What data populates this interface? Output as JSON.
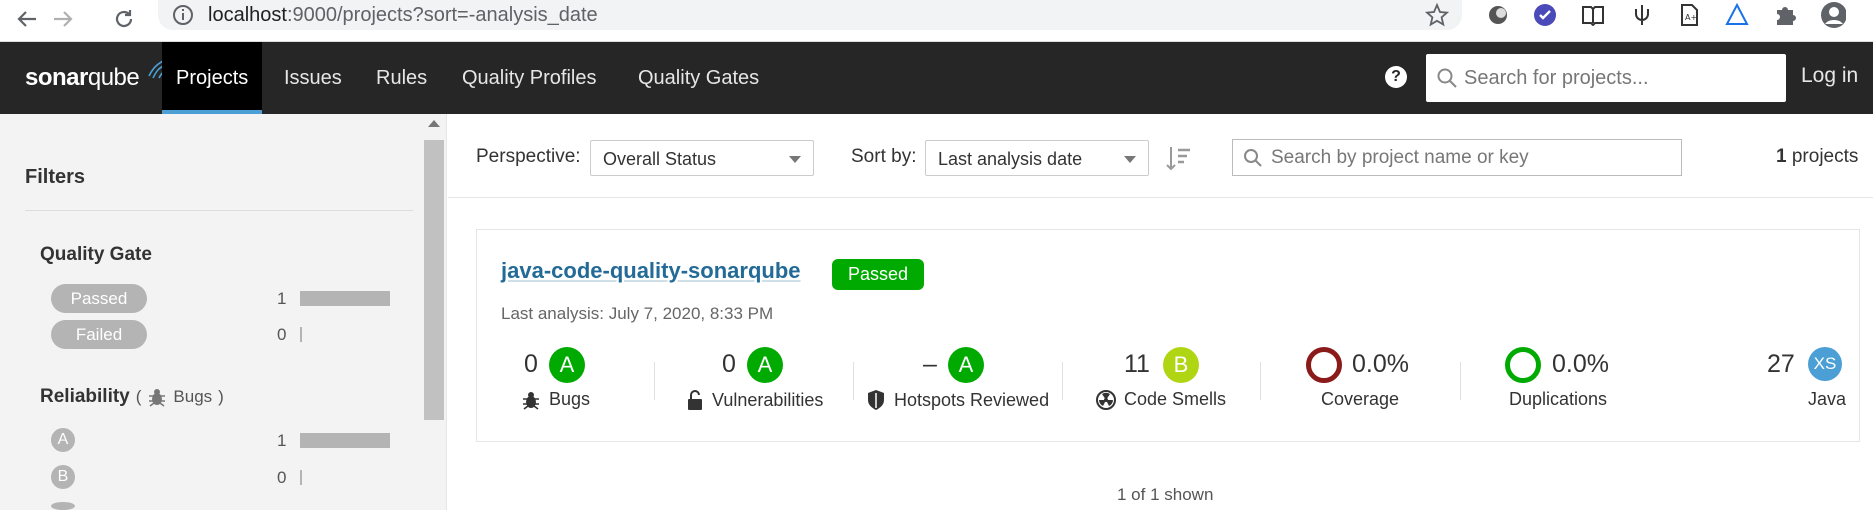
{
  "browser": {
    "url_host": "localhost",
    "url_rest": ":9000/projects?sort=-analysis_date",
    "icons": [
      "back-arrow-icon",
      "forward-arrow-icon",
      "reload-icon",
      "info-icon",
      "star-icon",
      "extension-icons",
      "puzzle-icon",
      "profile-icon"
    ]
  },
  "navbar": {
    "logo_bold": "sonar",
    "logo_rest": "qube",
    "items": [
      "Projects",
      "Issues",
      "Rules",
      "Quality Profiles",
      "Quality Gates"
    ],
    "active": "Projects",
    "help_label": "?",
    "search_placeholder": "Search for projects...",
    "login_label": "Log in",
    "colors": {
      "bg": "#262626",
      "active_underline": "#4b9fd5"
    }
  },
  "sidebar": {
    "title": "Filters",
    "quality_gate": {
      "title": "Quality Gate",
      "items": [
        {
          "label": "Passed",
          "count": "1",
          "fraction": 1.0
        },
        {
          "label": "Failed",
          "count": "0",
          "fraction": 0.0
        }
      ]
    },
    "reliability": {
      "title": "Reliability",
      "paren_open": "(",
      "sub": "Bugs",
      "paren_close": ")",
      "items": [
        {
          "label": "A",
          "count": "1",
          "fraction": 1.0
        },
        {
          "label": "B",
          "count": "0",
          "fraction": 0.0
        }
      ]
    }
  },
  "toolbar": {
    "perspective_label": "Perspective:",
    "perspective_value": "Overall Status",
    "sort_label": "Sort by:",
    "sort_value": "Last analysis date",
    "search_placeholder": "Search by project name or key",
    "count": "1",
    "count_suffix": "projects"
  },
  "project": {
    "name": "java-code-quality-sonarqube",
    "status": "Passed",
    "last_analysis": "Last analysis: July 7, 2020, 8:33 PM",
    "metrics": {
      "bugs": {
        "value": "0",
        "grade": "A",
        "label": "Bugs"
      },
      "vulnerabilities": {
        "value": "0",
        "grade": "A",
        "label": "Vulnerabilities"
      },
      "hotspots": {
        "value": "–",
        "grade": "A",
        "label": "Hotspots Reviewed"
      },
      "code_smells": {
        "value": "11",
        "grade": "B",
        "label": "Code Smells"
      },
      "coverage": {
        "value": "0.0%",
        "label": "Coverage"
      },
      "duplications": {
        "value": "0.0%",
        "label": "Duplications"
      },
      "size": {
        "value": "27",
        "badge": "XS",
        "label": "Java"
      }
    },
    "colors": {
      "grade_a": "#00aa00",
      "grade_b": "#b0d513",
      "passed": "#00aa00",
      "coverage_ring": "#8b1a1a",
      "dup_ring": "#00aa00",
      "size_badge": "#4b9fd5"
    }
  },
  "footer": {
    "shown": "1 of 1 shown"
  }
}
